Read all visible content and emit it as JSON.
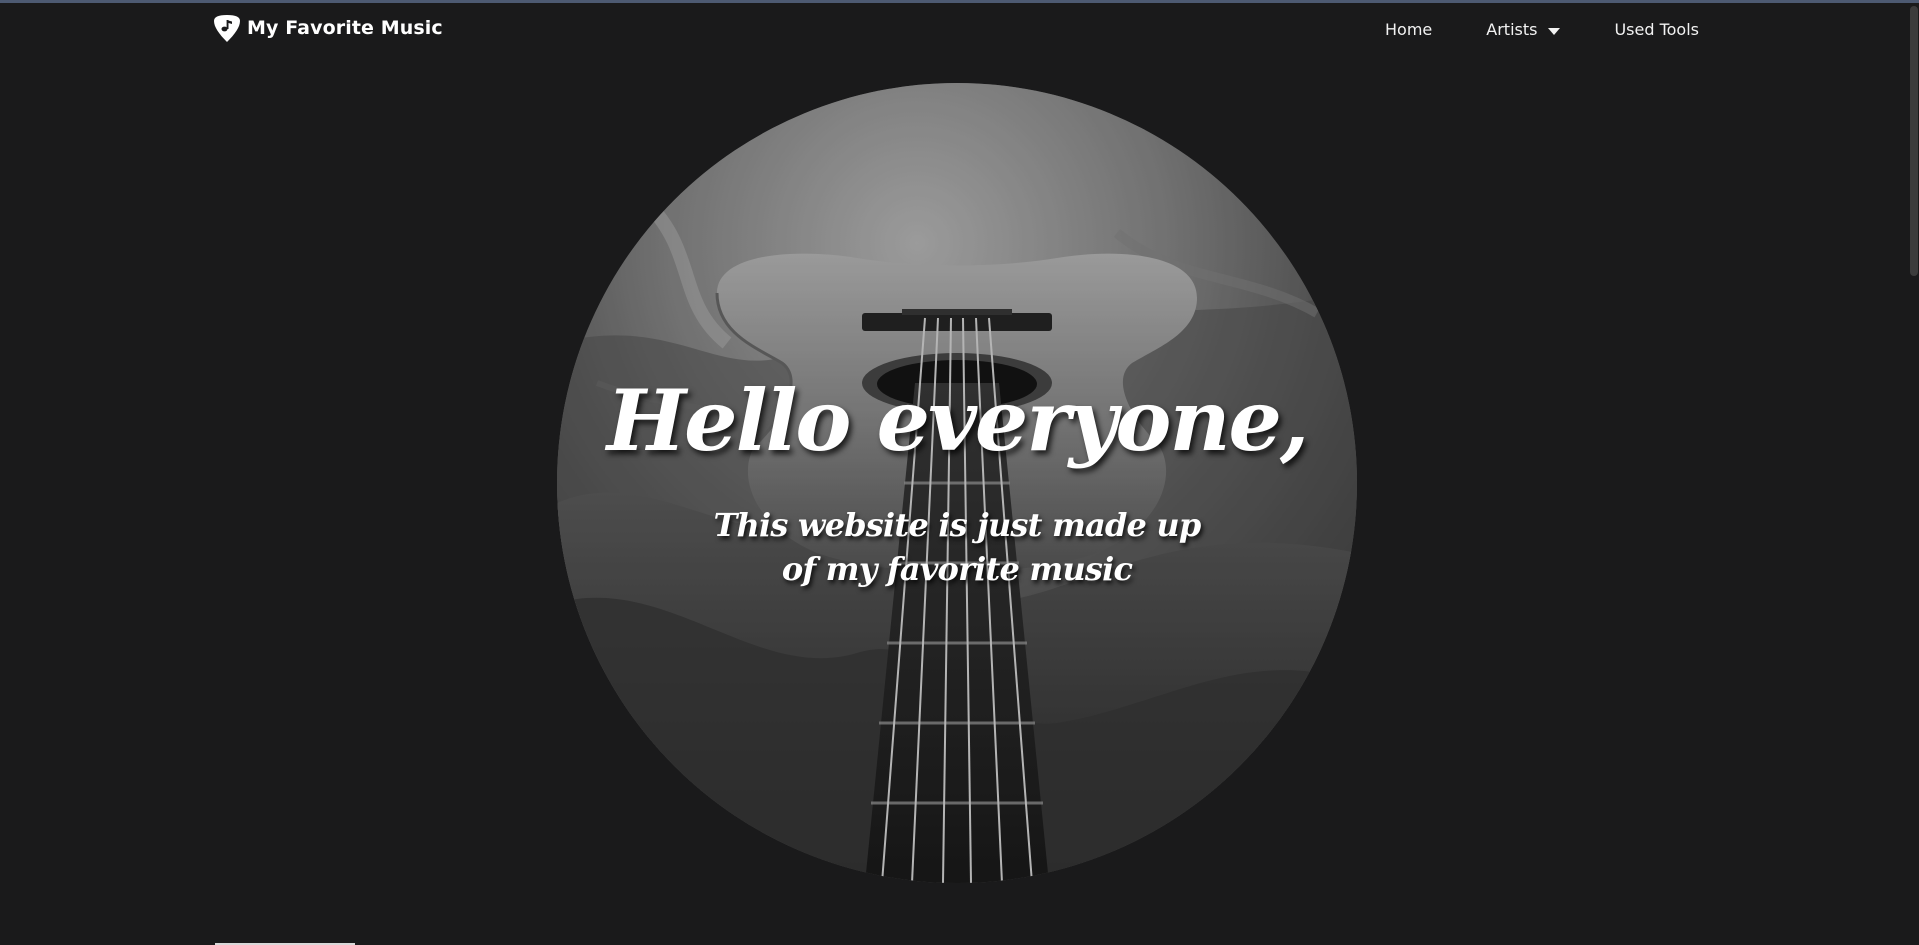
{
  "navbar": {
    "brand_icon": "guitar-pick-music-note-icon",
    "brand_text": "My Favorite Music",
    "links": [
      {
        "label": "Home"
      },
      {
        "label": "Artists",
        "icon": "caret-down-icon"
      },
      {
        "label": "Used Tools"
      }
    ]
  },
  "hero": {
    "image": "black-and-white acoustic guitar on bedsheets",
    "title": "Hello everyone,",
    "subtitle_line1": "This website is just made up",
    "subtitle_line2": "of my favorite music"
  },
  "colors": {
    "background": "#1a1a1b",
    "text": "#ffffff",
    "top_rule": "#4d5a72"
  }
}
